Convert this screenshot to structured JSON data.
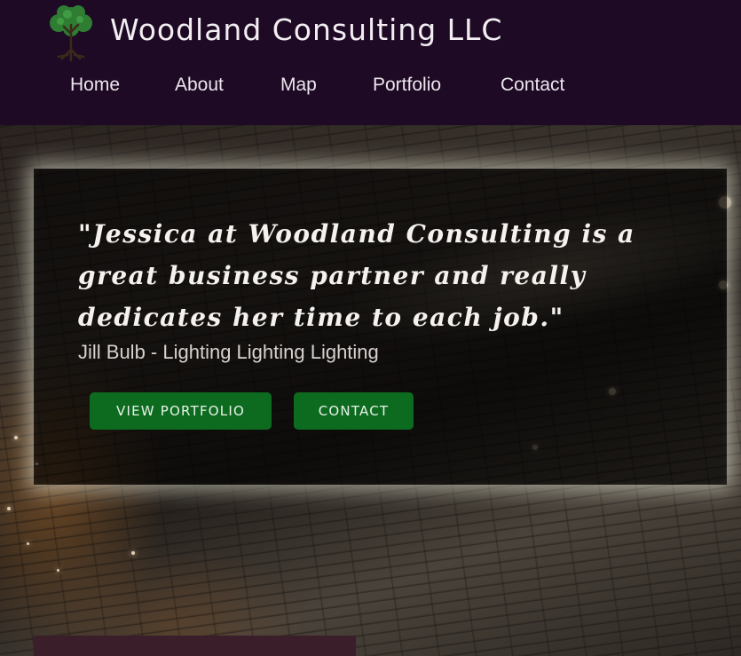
{
  "header": {
    "site_title": "Woodland Consulting LLC",
    "logo_icon": "tree-icon"
  },
  "nav": {
    "items": [
      {
        "label": "Home"
      },
      {
        "label": "About"
      },
      {
        "label": "Map"
      },
      {
        "label": "Portfolio"
      },
      {
        "label": "Contact"
      }
    ]
  },
  "hero": {
    "quote": "\"Jessica at Woodland Consulting is a great business partner and really dedicates her time to each job.\"",
    "attribution": "Jill Bulb - Lighting Lighting Lighting",
    "buttons": {
      "portfolio_label": "VIEW PORTFOLIO",
      "contact_label": "CONTACT"
    }
  },
  "colors": {
    "header_bg": "#1e0a24",
    "button_bg": "#0d6b1f",
    "panel_glow": "#fffbe6"
  }
}
